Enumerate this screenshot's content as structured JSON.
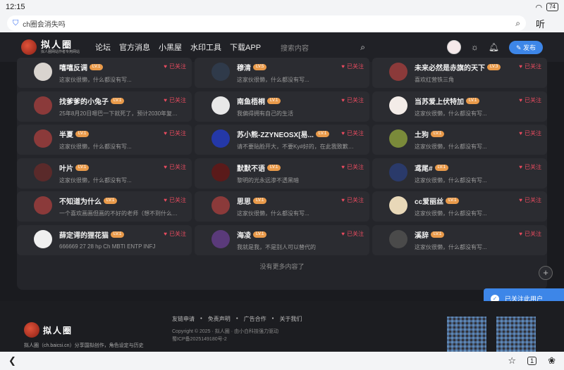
{
  "status": {
    "time": "12:15",
    "battery": "74"
  },
  "browser": {
    "url": "ch圈会消失吗",
    "listen": "听",
    "tabs": "1"
  },
  "nav": {
    "logo_text": "拟人圈",
    "logo_sub": "拟人圈网站作者专用网站",
    "links": [
      "论坛",
      "官方消息",
      "小黑屋",
      "水印工具",
      "下载APP"
    ],
    "search_placeholder": "搜索内容",
    "publish": "发布"
  },
  "follow_label": "已关注",
  "cards": [
    {
      "name": "嘻嘻反调",
      "level": "LV.1",
      "bio": "这家伙很懒，什么都没有写...",
      "avatar": "#d9d4cf"
    },
    {
      "name": "穆清",
      "level": "LV.5",
      "bio": "这家伙很懒，什么都没有写...",
      "avatar": "#2f3a4a"
    },
    {
      "name": "未来必然是赤旗的天下",
      "level": "LV.3",
      "bio": "喜欢红营铁三角",
      "avatar": "#8b3a3a"
    },
    {
      "name": "找爹爹的小兔子",
      "level": "LV.1",
      "bio": "25年8月20日嗯巴一下就死了，预计2030年复活...",
      "avatar": "#8b3a3a"
    },
    {
      "name": "南鱼梧桐",
      "level": "LV.1",
      "bio": "我偏得拥有自己的生活",
      "avatar": "#e8e8e8"
    },
    {
      "name": "当苏爱上伏特加",
      "level": "LV.1",
      "bio": "这家伙很懒，什么都没有写...",
      "avatar": "#f3ece8"
    },
    {
      "name": "半夏",
      "level": "LV.1",
      "bio": "这家伙很懒，什么都没有写...",
      "avatar": "#8b3a3a"
    },
    {
      "name": "苏小熊-ZZYNEOSX[易...",
      "level": "LV.1",
      "bio": "请不要贴脸开大，不要Ky#好的，在此我致歉一...",
      "avatar": "#2438a8"
    },
    {
      "name": "土狗",
      "level": "LV.1",
      "bio": "这家伙很懒，什么都没有写...",
      "avatar": "#7a8a3a"
    },
    {
      "name": "叶片",
      "level": "LV.1",
      "bio": "这家伙很懒，什么都没有写...",
      "avatar": "#5a2a2a"
    },
    {
      "name": "默默不语",
      "level": "LV.1",
      "bio": "黎明的光永远渗不透黑暗",
      "avatar": "#5a1a1a"
    },
    {
      "name": "鸢尾#",
      "level": "LV.1",
      "bio": "这家伙很懒，什么都没有写...",
      "avatar": "#2a3a6a"
    },
    {
      "name": "不知道为什么",
      "level": "LV.1",
      "bio": "一个喜欢画画但画的不好的老师（想不到什么称...",
      "avatar": "#8b3a3a"
    },
    {
      "name": "思思",
      "level": "LV.1",
      "bio": "这家伙很懒，什么都没有写...",
      "avatar": "#8b3a3a"
    },
    {
      "name": "cc爱丽丝",
      "level": "LV.1",
      "bio": "这家伙很懒，什么都没有写...",
      "avatar": "#e8d8b8"
    },
    {
      "name": "薛定谔的狸花猫",
      "level": "LV.1",
      "bio": "666669 27 28 hp Ch MBTI ENTP INFJ",
      "avatar": "#f0f0f0"
    },
    {
      "name": "海凌",
      "level": "LV.1",
      "bio": "我就是我，不是别人可以替代的",
      "avatar": "#5a3a7a"
    },
    {
      "name": "溪辞",
      "level": "LV.1",
      "bio": "这家伙很懒，什么都没有写...",
      "avatar": "#4a4a4a"
    }
  ],
  "no_more": "没有更多内容了",
  "toast": "已关注此用户",
  "footer": {
    "logo_text": "拟人圈",
    "desc": "拟人圈（ch.baicsi.cn）分享国拟创作，角色设定与历史",
    "links": [
      "友链申请",
      "免责声明",
      "广告合作",
      "关于我们"
    ],
    "copyright": "Copyright © 2025 · 拟人圈 · 由小白科技强力驱动",
    "icp": "蜀ICP备2025149180号-2"
  }
}
